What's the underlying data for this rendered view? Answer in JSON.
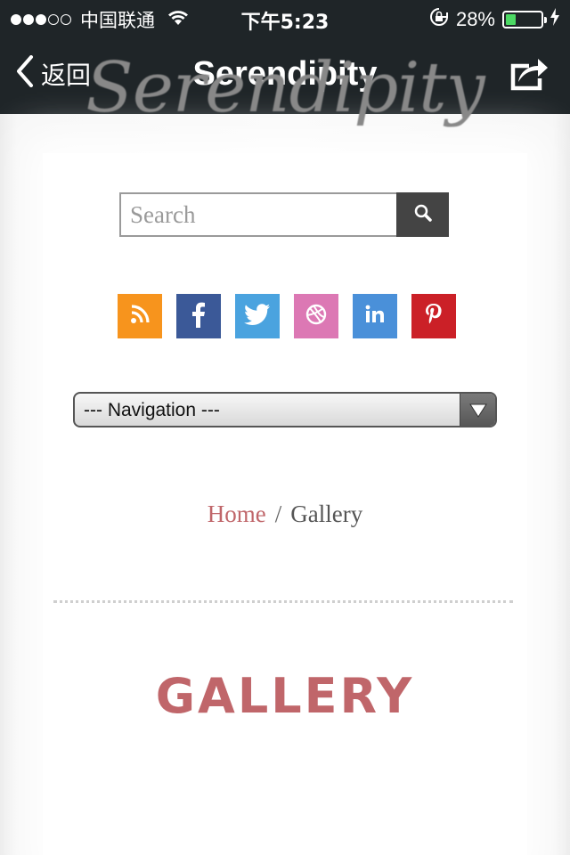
{
  "status_bar": {
    "carrier": "中国联通",
    "time": "下午5:23",
    "battery_percent": "28%",
    "battery_level": 0.28,
    "signal_bars_filled": 3,
    "signal_bars_total": 5
  },
  "nav_bar": {
    "back_label": "返回",
    "title": "Serendipity"
  },
  "site": {
    "logo_text": "Serendipity",
    "search": {
      "placeholder": "Search",
      "value": ""
    },
    "social": [
      {
        "name": "rss",
        "color": "#f7941d"
      },
      {
        "name": "facebook",
        "color": "#3b5998"
      },
      {
        "name": "twitter",
        "color": "#4aa3df"
      },
      {
        "name": "dribbble",
        "color": "#dc78b4"
      },
      {
        "name": "linkedin",
        "color": "#4a90d9"
      },
      {
        "name": "pinterest",
        "color": "#cb2027"
      }
    ],
    "navigation_select": "--- Navigation ---",
    "breadcrumb": {
      "home": "Home",
      "separator": "/",
      "current": "Gallery"
    },
    "heading": "GALLERY",
    "accent_color": "#c0666a"
  }
}
